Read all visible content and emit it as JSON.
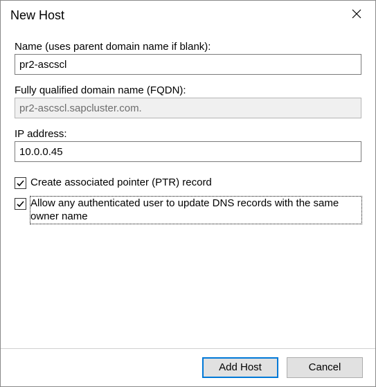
{
  "window": {
    "title": "New Host"
  },
  "fields": {
    "name": {
      "label": "Name (uses parent domain name if blank):",
      "value": "pr2-ascscl"
    },
    "fqdn": {
      "label": "Fully qualified domain name (FQDN):",
      "value": "pr2-ascscl.sapcluster.com."
    },
    "ip": {
      "label": "IP address:",
      "value": "10.0.0.45"
    }
  },
  "checks": {
    "ptr": {
      "label": "Create associated pointer (PTR) record",
      "checked": true
    },
    "allow_update": {
      "label": "Allow any authenticated user to update DNS records with the same owner name",
      "checked": true
    }
  },
  "buttons": {
    "add_host": "Add Host",
    "cancel": "Cancel"
  }
}
